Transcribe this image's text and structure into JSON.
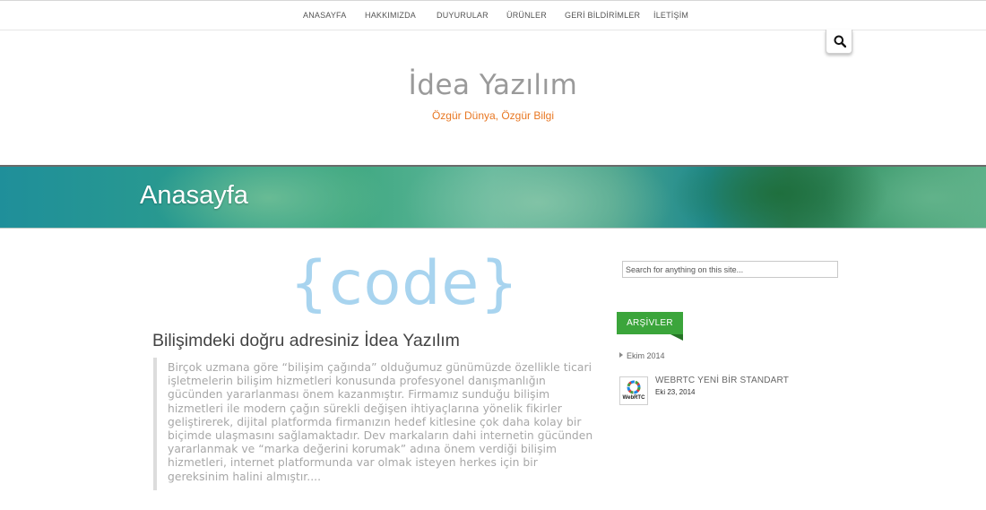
{
  "nav": {
    "items": [
      {
        "label": "ANASAYFA"
      },
      {
        "label": "HAKKIMIZDA"
      },
      {
        "label": "DUYURULAR"
      },
      {
        "label": "ÜRÜNLER"
      },
      {
        "label": "GERİ BİLDİRİMLER"
      },
      {
        "label": "İLETİŞİM"
      }
    ]
  },
  "header": {
    "site_title": "İdea Yazılım",
    "tagline": "Özgür Dünya, Özgür Bilgi",
    "search_icon": "search-icon"
  },
  "banner": {
    "title": "Anasayfa"
  },
  "main": {
    "logo_text": "{code}",
    "post_title": "Bilişimdeki doğru adresiniz İdea Yazılım",
    "post_excerpt": "Birçok uzmana göre “bilişim çağında” olduğumuz günümüzde özellikle ticari işletmelerin bilişim hizmetleri konusunda profesyonel danışmanlığın gücünden yararlanması önem kazanmıştır. Firmamız sunduğu bilişim hizmetleri ile modern çağın sürekli değişen ihtiyaçlarına yönelik fikirler geliştirerek, dijital platformda firmanızın hedef kitlesine çok daha kolay bir biçimde ulaşmasını sağlamaktadır. Dev markaların dahi internetin gücünden yararlanmak ve “marka değerini korumak” adına önem verdiği bilişim hizmetleri, internet platformunda var olmak isteyen herkes için bir gereksinim halini almıştır...."
  },
  "sidebar": {
    "search_placeholder": "Search for anything on this site...",
    "widget_title": "ARŞİVLER",
    "archive_item": "Ekim 2014",
    "recent_post": {
      "title": "WEBRTC YENİ BİR STANDART",
      "date": "Eki 23, 2014",
      "thumb_label": "WebRTC"
    }
  },
  "colors": {
    "tagline": "#e87722",
    "widget": "#3ba53b",
    "logo": "#a8d4ef"
  }
}
